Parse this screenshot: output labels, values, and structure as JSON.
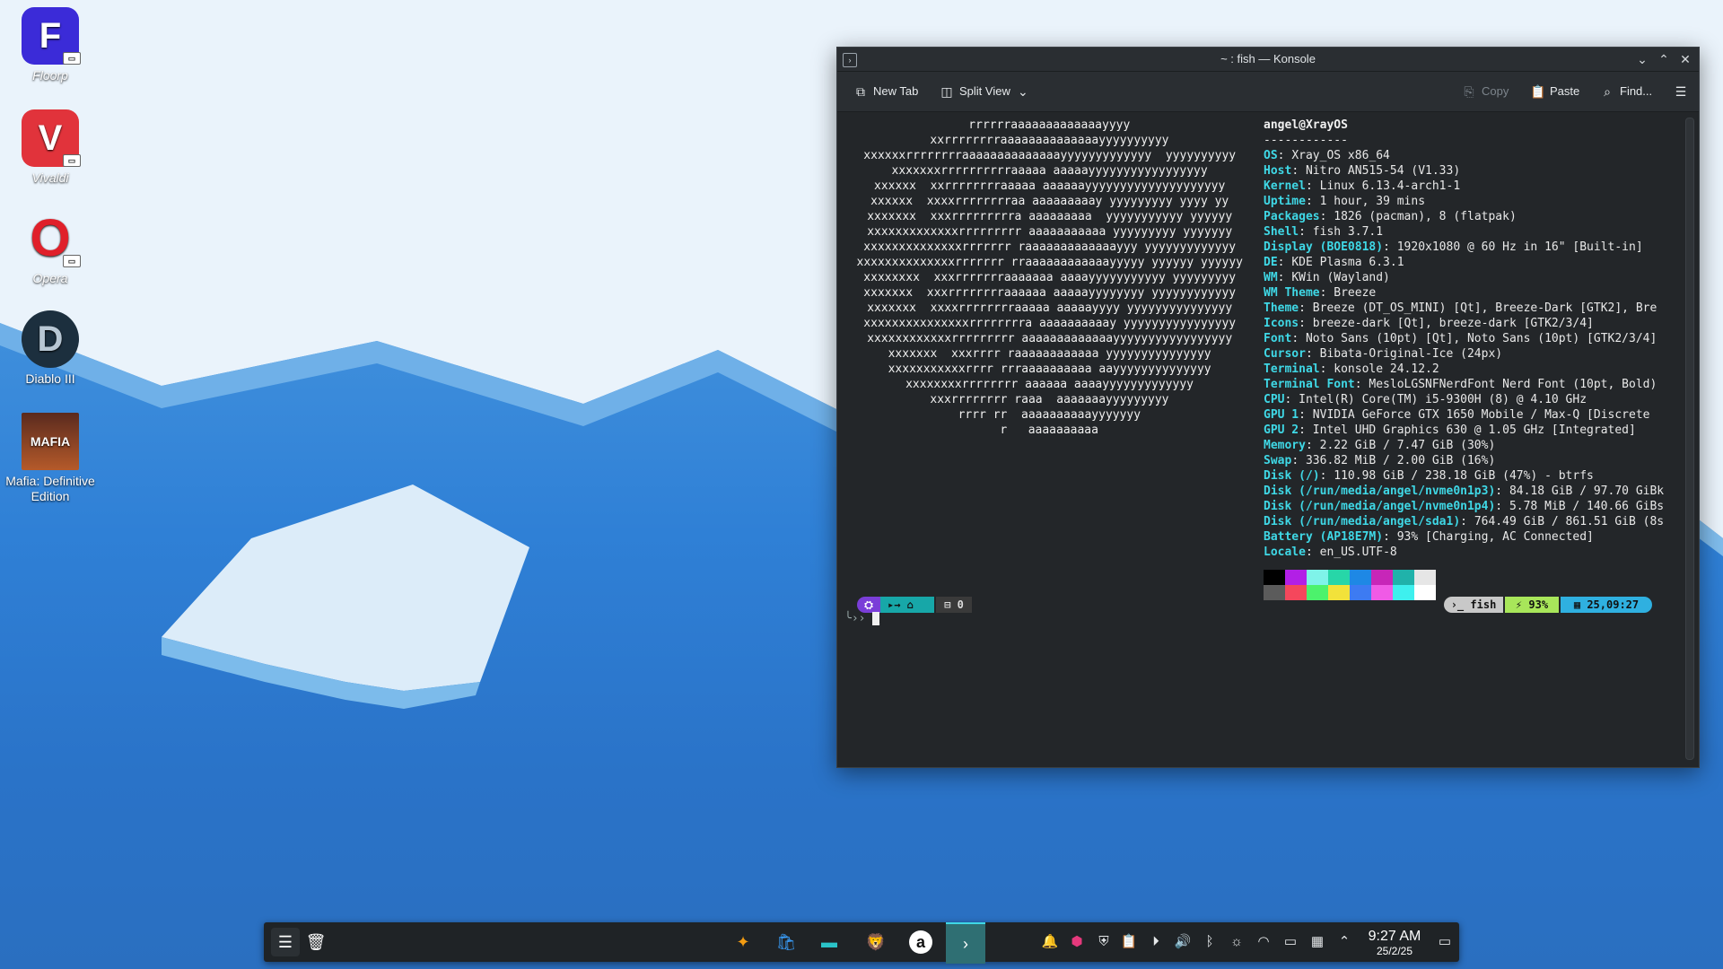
{
  "desktop": {
    "icons": [
      {
        "label": "Floorp"
      },
      {
        "label": "Vivaldi"
      },
      {
        "label": "Opera"
      },
      {
        "label": "Diablo III"
      },
      {
        "label": "Mafia: Definitive Edition"
      }
    ]
  },
  "window": {
    "title": "~ : fish — Konsole",
    "toolbar": {
      "new_tab": "New Tab",
      "split_view": "Split View",
      "copy": "Copy",
      "paste": "Paste",
      "find": "Find..."
    }
  },
  "terminal": {
    "art": [
      "rrrrrraaaaaaaaaaaaayyyy",
      "xxrrrrrrrraaaaaaaaaaaaaayyyyyyyyyy",
      "xxxxxxrrrrrrrraaaaaaaaaaaaaayyyyyyyyyyyyy  yyyyyyyyyy",
      "xxxxxxxrrrrrrrrrraaaaa aaaaayyyyyyyyyyyyyyyyy",
      "xxxxxx  xxrrrrrrrraaaaa aaaaaayyyyyyyyyyyyyyyyyyyy",
      "xxxxxx  xxxxrrrrrrrraa aaaaaaaaay yyyyyyyyy yyyy yy",
      "xxxxxxx  xxxrrrrrrrrra aaaaaaaaa  yyyyyyyyyyy yyyyyy",
      "xxxxxxxxxxxxxrrrrrrrrr aaaaaaaaaaa yyyyyyyyy yyyyyyy",
      "xxxxxxxxxxxxxxrrrrrrr raaaaaaaaaaaaayyy yyyyyyyyyyyyy",
      "xxxxxxxxxxxxxxrrrrrrr rraaaaaaaaaaaayyyyy yyyyyy yyyyyy",
      "xxxxxxxx  xxxrrrrrrraaaaaaa aaaayyyyyyyyyyy yyyyyyyyy",
      "xxxxxxx  xxxrrrrrrrraaaaaa aaaaayyyyyyyy yyyyyyyyyyyy",
      "xxxxxxx  xxxxrrrrrrrraaaaa aaaaayyyy yyyyyyyyyyyyyyy",
      "xxxxxxxxxxxxxxxrrrrrrrra aaaaaaaaaay yyyyyyyyyyyyyyyy",
      "xxxxxxxxxxxxrrrrrrrrr aaaaaaaaaaaaayyyyyyyyyyyyyyyyy",
      "xxxxxxx  xxxrrrr raaaaaaaaaaaa yyyyyyyyyyyyyyy",
      "xxxxxxxxxxxrrrr rrraaaaaaaaaa aayyyyyyyyyyyyyy",
      "xxxxxxxxrrrrrrrr aaaaaa aaaayyyyyyyyyyyyy",
      "xxxrrrrrrrr raaa  aaaaaaayyyyyyyyy",
      "rrrr rr  aaaaaaaaaayyyyyyy",
      "r   aaaaaaaaaa"
    ],
    "user_host": "angel@XrayOS",
    "separator": "------------",
    "info": [
      {
        "key": "OS",
        "value": "Xray_OS x86_64"
      },
      {
        "key": "Host",
        "value": "Nitro AN515-54 (V1.33)"
      },
      {
        "key": "Kernel",
        "value": "Linux 6.13.4-arch1-1"
      },
      {
        "key": "Uptime",
        "value": "1 hour, 39 mins"
      },
      {
        "key": "Packages",
        "value": "1826 (pacman), 8 (flatpak)"
      },
      {
        "key": "Shell",
        "value": "fish 3.7.1"
      },
      {
        "key": "Display (BOE0818)",
        "value": "1920x1080 @ 60 Hz in 16\" [Built-in]"
      },
      {
        "key": "DE",
        "value": "KDE Plasma 6.3.1"
      },
      {
        "key": "WM",
        "value": "KWin (Wayland)"
      },
      {
        "key": "WM Theme",
        "value": "Breeze"
      },
      {
        "key": "Theme",
        "value": "Breeze (DT_OS_MINI) [Qt], Breeze-Dark [GTK2], Bre"
      },
      {
        "key": "Icons",
        "value": "breeze-dark [Qt], breeze-dark [GTK2/3/4]"
      },
      {
        "key": "Font",
        "value": "Noto Sans (10pt) [Qt], Noto Sans (10pt) [GTK2/3/4]"
      },
      {
        "key": "Cursor",
        "value": "Bibata-Original-Ice (24px)"
      },
      {
        "key": "Terminal",
        "value": "konsole 24.12.2"
      },
      {
        "key": "Terminal Font",
        "value": "MesloLGSNFNerdFont Nerd Font (10pt, Bold)"
      },
      {
        "key": "CPU",
        "value": "Intel(R) Core(TM) i5-9300H (8) @ 4.10 GHz"
      },
      {
        "key": "GPU 1",
        "value": "NVIDIA GeForce GTX 1650 Mobile / Max-Q [Discrete"
      },
      {
        "key": "GPU 2",
        "value": "Intel UHD Graphics 630 @ 1.05 GHz [Integrated]"
      },
      {
        "key": "Memory",
        "value": "2.22 GiB / 7.47 GiB (30%)"
      },
      {
        "key": "Swap",
        "value": "336.82 MiB / 2.00 GiB (16%)"
      },
      {
        "key": "Disk (/)",
        "value": "110.98 GiB / 238.18 GiB (47%) - btrfs"
      },
      {
        "key": "Disk (/run/media/angel/nvme0n1p3)",
        "value": "84.18 GiB / 97.70 GiBk"
      },
      {
        "key": "Disk (/run/media/angel/nvme0n1p4)",
        "value": "5.78 MiB / 140.66 GiBs"
      },
      {
        "key": "Disk (/run/media/angel/sda1)",
        "value": "764.49 GiB / 861.51 GiB (8s"
      },
      {
        "key": "Battery (AP18E7M)",
        "value": "93% [Charging, AC Connected]"
      },
      {
        "key": "Locale",
        "value": "en_US.UTF-8"
      }
    ],
    "palette_top": [
      "#000000",
      "#b21fe6",
      "#7ff3e9",
      "#27d6a8",
      "#1e88e5",
      "#c726b8",
      "#20b2aa",
      "#e6e6e6"
    ],
    "palette_bottom": [
      "#5b5b5b",
      "#f5475c",
      "#4cf26c",
      "#f2e23a",
      "#3d7bf2",
      "#f05ae6",
      "#3ef0ee",
      "#ffffff"
    ],
    "prompt": {
      "left_dir": "~",
      "jobs": "0",
      "shell": "fish",
      "battery": "93%",
      "time": "25,09:27"
    }
  },
  "taskbar": {
    "time": "9:27 AM",
    "date": "25/2/25"
  }
}
